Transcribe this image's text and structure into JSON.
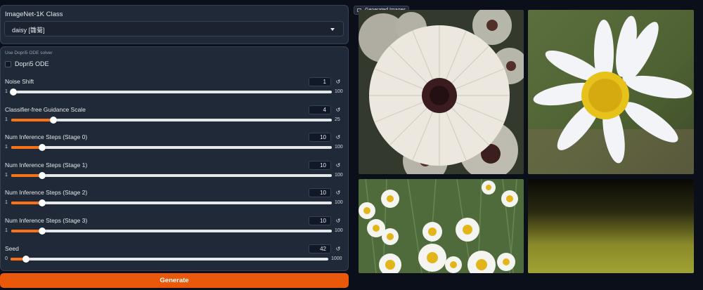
{
  "class_panel": {
    "label": "ImageNet-1K Class",
    "selected": "daisy [雛菊]"
  },
  "settings": {
    "solver_caption": "Use Dopri5 ODE solver",
    "checkbox_label": "Dopri5 ODE",
    "checkbox_checked": false,
    "sliders": [
      {
        "label": "Noise Shift",
        "value": "1",
        "min": "1",
        "max": "100",
        "fraction": 0.0
      },
      {
        "label": "Classifier-free Guidance Scale",
        "value": "4",
        "min": "1",
        "max": "25",
        "fraction": 0.125
      },
      {
        "label": "Num Inference Steps (Stage 0)",
        "value": "10",
        "min": "1",
        "max": "100",
        "fraction": 0.091
      },
      {
        "label": "Num Inference Steps (Stage 1)",
        "value": "10",
        "min": "1",
        "max": "100",
        "fraction": 0.091
      },
      {
        "label": "Num Inference Steps (Stage 2)",
        "value": "10",
        "min": "1",
        "max": "100",
        "fraction": 0.091
      },
      {
        "label": "Num Inference Steps (Stage 3)",
        "value": "10",
        "min": "1",
        "max": "100",
        "fraction": 0.091
      },
      {
        "label": "Seed",
        "value": "42",
        "min": "0",
        "max": "1000",
        "fraction": 0.042
      }
    ],
    "reset_icon": "refresh-icon"
  },
  "generate_label": "Generate",
  "gallery": {
    "label": "Generated Images",
    "icon": "image-icon"
  },
  "colors": {
    "accent": "#ea580c",
    "panel": "#1f2937",
    "background": "#0b0f19"
  }
}
